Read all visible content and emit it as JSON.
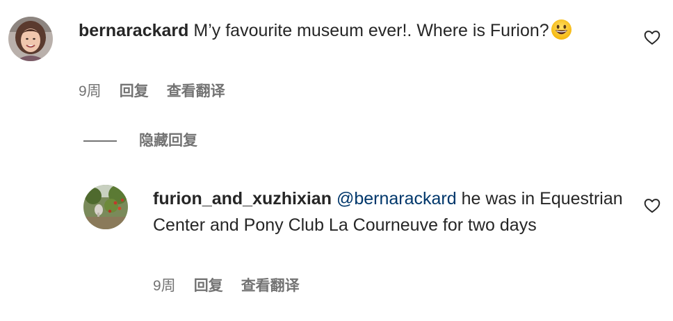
{
  "comments": [
    {
      "username": "bernarackard",
      "text": "M’y favourite museum ever!. Where is Furion?",
      "emoji": "grinning-face-emoji",
      "time": "9周",
      "reply_label": "回复",
      "translate_label": "查看翻译",
      "like_icon": "heart-outline-icon"
    }
  ],
  "thread": {
    "hide_replies_label": "隐藏回复"
  },
  "replies": [
    {
      "username": "furion_and_xuzhixian",
      "mention": "@bernarackard",
      "text": "he was in Equestrian Center and Pony Club La Courneuve for two days",
      "time": "9周",
      "reply_label": "回复",
      "translate_label": "查看翻译",
      "like_icon": "heart-outline-icon"
    }
  ],
  "colors": {
    "text_primary": "#262626",
    "text_secondary": "#737373",
    "mention": "#00376b",
    "background": "#ffffff"
  }
}
